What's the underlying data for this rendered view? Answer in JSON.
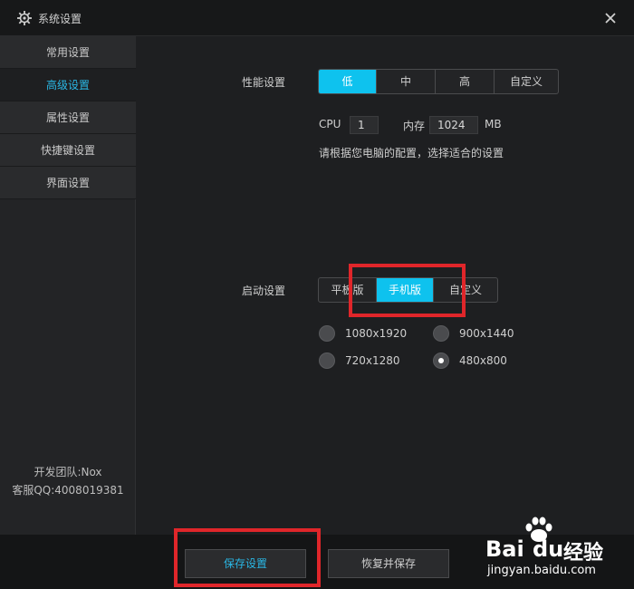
{
  "window": {
    "title": "系统设置"
  },
  "sidebar": {
    "items": [
      {
        "label": "常用设置",
        "active": false
      },
      {
        "label": "高级设置",
        "active": true
      },
      {
        "label": "属性设置",
        "active": false
      },
      {
        "label": "快捷键设置",
        "active": false
      },
      {
        "label": "界面设置",
        "active": false
      }
    ],
    "footer": {
      "team": "开发团队:Nox",
      "qq": "客服QQ:4008019381"
    }
  },
  "performance": {
    "label": "性能设置",
    "options": [
      "低",
      "中",
      "高",
      "自定义"
    ],
    "selected": "低",
    "cpu_label": "CPU",
    "cpu_value": "1",
    "mem_label": "内存",
    "mem_value": "1024",
    "mem_unit": "MB",
    "hint": "请根据您电脑的配置，选择适合的设置"
  },
  "startup": {
    "label": "启动设置",
    "options": [
      "平板版",
      "手机版",
      "自定义"
    ],
    "selected": "手机版",
    "resolutions": [
      {
        "label": "1080x1920",
        "checked": false
      },
      {
        "label": "900x1440",
        "checked": false
      },
      {
        "label": "720x1280",
        "checked": false
      },
      {
        "label": "480x800",
        "checked": true
      }
    ]
  },
  "actions": {
    "save": "保存设置",
    "restore_save": "恢复并保存"
  },
  "watermark": {
    "brand": "Bai",
    "brand2": "du",
    "jingyan": "经验",
    "url": "jingyan.baidu.com"
  },
  "colors": {
    "accent": "#0ec2ee",
    "highlight": "#e0262a",
    "bg": "#1e1f21"
  }
}
